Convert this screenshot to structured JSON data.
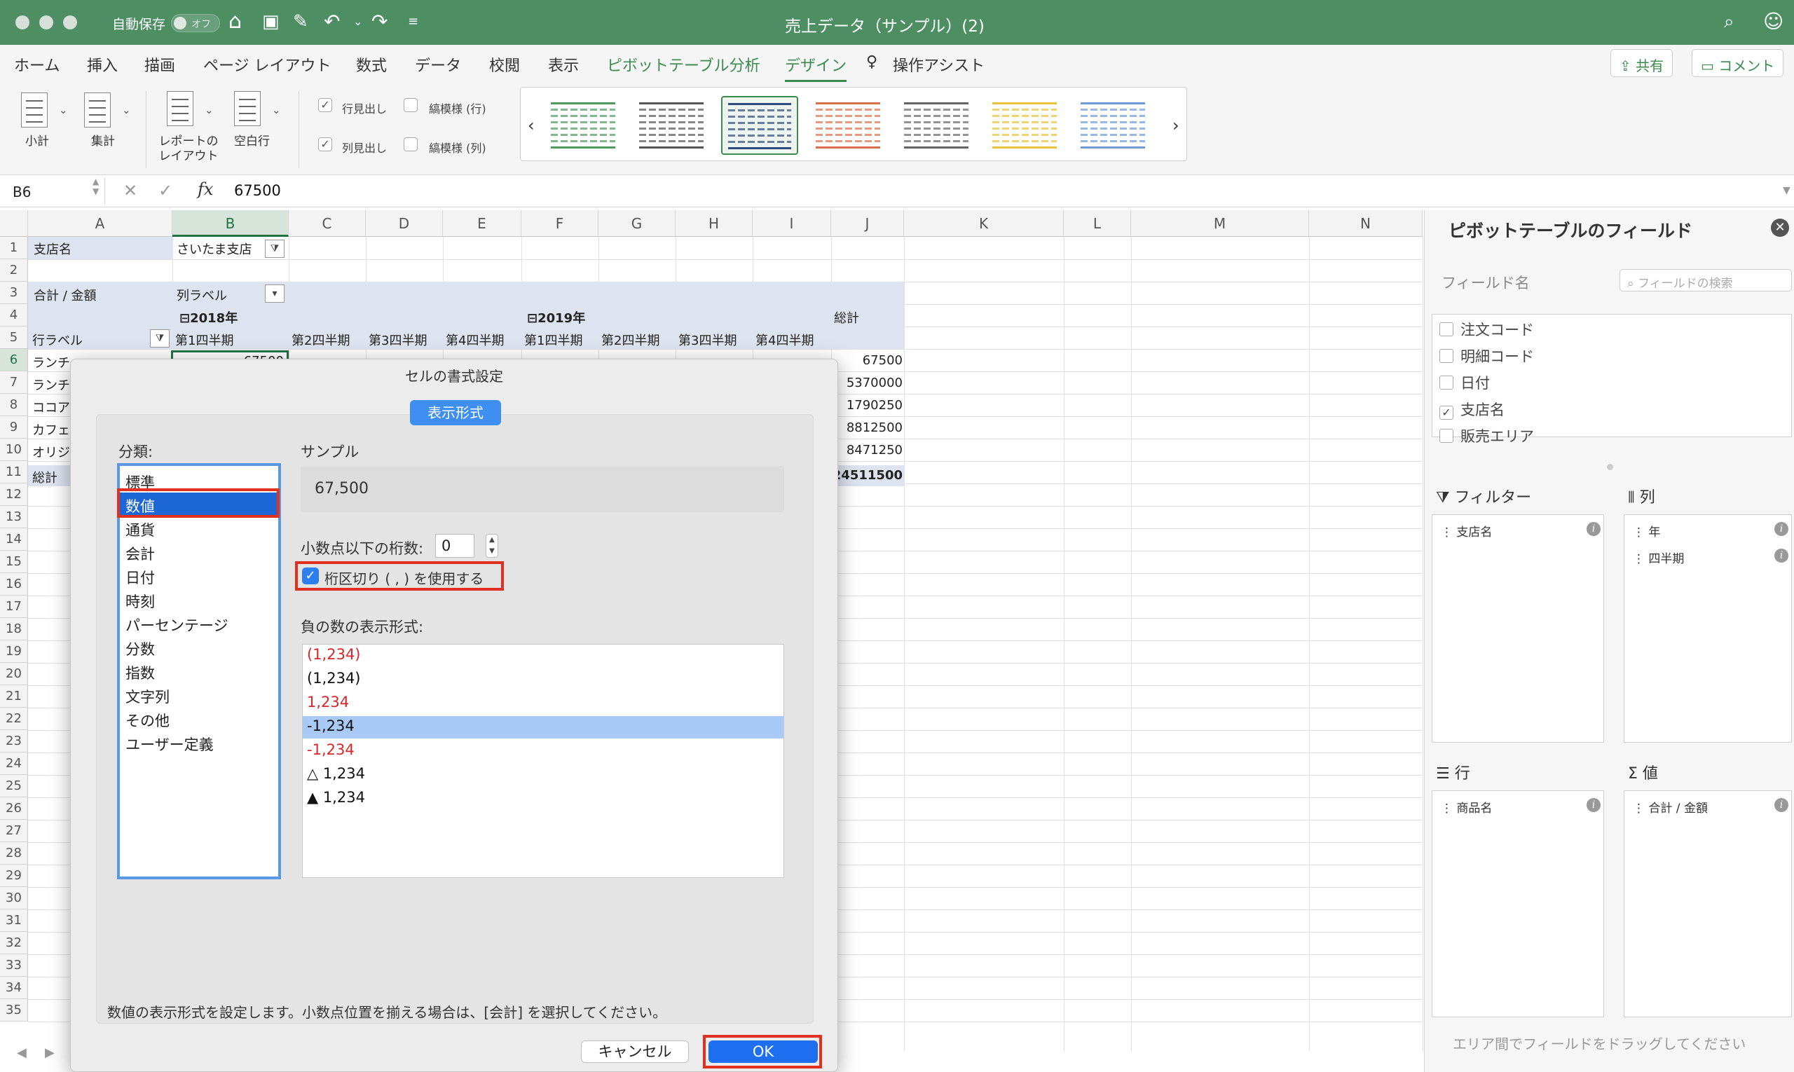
{
  "titlebar": {
    "autosave_label": "自動保存",
    "autosave_state": "オフ",
    "doc_title": "売上データ（サンプル）(2)"
  },
  "ribbon_tabs": [
    "ホーム",
    "挿入",
    "描画",
    "ページ レイアウト",
    "数式",
    "データ",
    "校閲",
    "表示",
    "ピボットテーブル分析",
    "デザイン",
    "操作アシスト"
  ],
  "ribbon_actions": {
    "share": "共有",
    "comment": "コメント"
  },
  "ribbon": {
    "subtotal": "小計",
    "grandtotal": "集計",
    "report_layout_line1": "レポートの",
    "report_layout_line2": "レイアウト",
    "blank_rows": "空白行",
    "row_headers": "行見出し",
    "col_headers": "列見出し",
    "banded_rows": "縞模様 (行)",
    "banded_cols": "縞模様 (列)"
  },
  "style_colors": [
    "#4e9a5e",
    "#555555",
    "#2e4a7a",
    "#d8704a",
    "#666666",
    "#e8c23a",
    "#6e9bd6"
  ],
  "formula_bar": {
    "cell_ref": "B6",
    "value": "67500"
  },
  "columns": [
    "A",
    "B",
    "C",
    "D",
    "E",
    "F",
    "G",
    "H",
    "I",
    "J",
    "K",
    "L",
    "M",
    "N"
  ],
  "rows": [
    "1",
    "2",
    "3",
    "4",
    "5",
    "6",
    "7",
    "8",
    "9",
    "10",
    "11",
    "12",
    "13",
    "14",
    "15",
    "16",
    "17",
    "18",
    "19",
    "20",
    "21",
    "22",
    "23",
    "24",
    "25",
    "26",
    "27",
    "28",
    "29",
    "30",
    "31",
    "32",
    "33",
    "34",
    "35"
  ],
  "pivot": {
    "a1": "支店名",
    "b1": "さいたま支店",
    "a3": "合計 / 金額",
    "b3": "列ラベル",
    "year1": "2018年",
    "year2": "2019年",
    "grand_total": "総計",
    "a5": "行ラベル",
    "quarters": [
      "第1四半期",
      "第2四半期",
      "第3四半期",
      "第4四半期",
      "第1四半期",
      "第2四半期",
      "第3四半期",
      "第4四半期"
    ],
    "row_labels": [
      "ランチ",
      "ランチ",
      "ココア",
      "カフェ",
      "オリジ",
      "総計"
    ],
    "b6": "67500",
    "totals": [
      "67500",
      "5370000",
      "1790250",
      "8812500",
      "8471250",
      "24511500"
    ]
  },
  "field_pane": {
    "title": "ピボットテーブルのフィールド",
    "field_name_label": "フィールド名",
    "search_placeholder": "フィールドの検索",
    "fields": [
      {
        "label": "注文コード",
        "checked": false
      },
      {
        "label": "明細コード",
        "checked": false
      },
      {
        "label": "日付",
        "checked": false
      },
      {
        "label": "支店名",
        "checked": true
      },
      {
        "label": "販売エリア",
        "checked": false
      }
    ],
    "filter_header": "フィルター",
    "columns_header": "列",
    "rows_header": "行",
    "values_header": "値",
    "filter_items": [
      "支店名"
    ],
    "columns_items": [
      "年",
      "四半期"
    ],
    "rows_items": [
      "商品名"
    ],
    "values_items": [
      "合計 / 金額"
    ],
    "footer": "エリア間でフィールドをドラッグしてください"
  },
  "dialog": {
    "title": "セルの書式設定",
    "tab": "表示形式",
    "category_label": "分類:",
    "categories": [
      "標準",
      "数値",
      "通貨",
      "会計",
      "日付",
      "時刻",
      "パーセンテージ",
      "分数",
      "指数",
      "文字列",
      "その他",
      "ユーザー定義"
    ],
    "selected_category": "数値",
    "sample_label": "サンプル",
    "sample_value": "67,500",
    "decimals_label": "小数点以下の桁数:",
    "decimals_value": "0",
    "separator_label": "桁区切り ( , ) を使用する",
    "negative_label": "負の数の表示形式:",
    "negative_formats": [
      {
        "text": "(1,234)",
        "red": true
      },
      {
        "text": "(1,234)",
        "red": false
      },
      {
        "text": "1,234",
        "red": true
      },
      {
        "text": "-1,234",
        "red": false
      },
      {
        "text": "-1,234",
        "red": true
      },
      {
        "text": "△ 1,234",
        "red": false
      },
      {
        "text": "▲ 1,234",
        "red": false
      }
    ],
    "selected_negative": "-1,234",
    "description": "数値の表示形式を設定します。小数点位置を揃える場合は、[会計] を選択してください。",
    "cancel": "キャンセル",
    "ok": "OK"
  }
}
